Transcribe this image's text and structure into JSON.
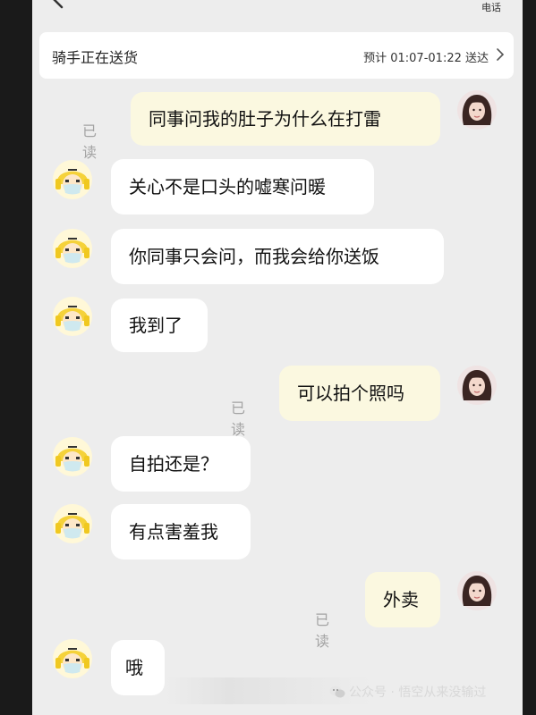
{
  "header": {
    "phone_label": "电话"
  },
  "delivery": {
    "status": "骑手正在送货",
    "eta": "预计 01:07-01:22 送达"
  },
  "messages": [
    {
      "text": "同事问我的肚子为什么在打雷",
      "read": "已读"
    },
    {
      "text": "关心不是口头的嘘寒问暖"
    },
    {
      "text": "你同事只会问，而我会给你送饭"
    },
    {
      "text": "我到了"
    },
    {
      "text": "可以拍个照吗",
      "read": "已读"
    },
    {
      "text": "自拍还是？"
    },
    {
      "text": "有点害羞我"
    },
    {
      "text": "外卖",
      "read": "已读"
    },
    {
      "text": "哦"
    }
  ],
  "watermark": {
    "text": "公众号 · 悟空从来没输过"
  },
  "icons": {
    "back": "chevron-left-icon",
    "forward": "chevron-right-icon",
    "rider_avatar": "rider-avatar-icon",
    "user_avatar": "user-avatar-icon",
    "wechat": "wechat-icon"
  },
  "colors": {
    "background": "#ededed",
    "outgoing_bubble": "#fbf8e0",
    "incoming_bubble": "#ffffff",
    "read_text": "#a3a3a3",
    "helmet": "#f5d23a"
  }
}
